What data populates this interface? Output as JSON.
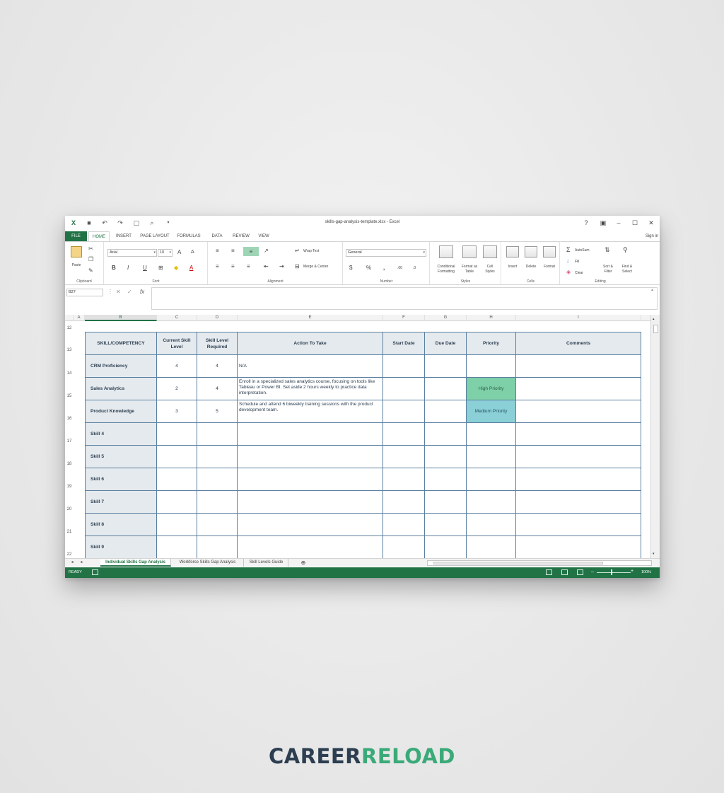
{
  "window": {
    "title": "skills-gap-analysis-template.xlsx - Excel",
    "help": "?",
    "sign_in": "Sign in"
  },
  "ribbon_tabs": [
    "FILE",
    "HOME",
    "INSERT",
    "PAGE LAYOUT",
    "FORMULAS",
    "DATA",
    "REVIEW",
    "VIEW"
  ],
  "ribbon": {
    "paste": "Paste",
    "clipboard": "Clipboard",
    "font_name": "Arial",
    "font_size": "10",
    "font": "Font",
    "bold": "B",
    "italic": "I",
    "underline": "U",
    "alignment": "Alignment",
    "wrap_text": "Wrap Text",
    "merge_center": "Merge & Center",
    "number_format": "General",
    "number": "Number",
    "currency": "$",
    "percent": "%",
    "comma": ",",
    "conditional_formatting": [
      "Conditional",
      "Formatting"
    ],
    "format_as_table": [
      "Format as",
      "Table"
    ],
    "cell_styles": [
      "Cell",
      "Styles"
    ],
    "styles": "Styles",
    "insert": "Insert",
    "delete": "Delete",
    "format": "Format",
    "cells": "Cells",
    "autosum": "AutoSum",
    "fill": "Fill",
    "clear": "Clear",
    "sort_filter": [
      "Sort &",
      "Filter"
    ],
    "find_select": [
      "Find &",
      "Select"
    ],
    "editing": "Editing"
  },
  "formula_bar": {
    "name_box": "B27",
    "fx": "fx",
    "value": ""
  },
  "columns": [
    "A",
    "B",
    "C",
    "D",
    "E",
    "F",
    "G",
    "H",
    "I"
  ],
  "rows": [
    "12",
    "13",
    "14",
    "15",
    "16",
    "17",
    "18",
    "19",
    "20",
    "21",
    "22"
  ],
  "table": {
    "headers": [
      "SKILL/COMPETENCY",
      "Current Skill Level",
      "Skill Level Required",
      "Action To Take",
      "Start Date",
      "Due Date",
      "Priority",
      "Comments"
    ],
    "rows": [
      {
        "skill": "CRM Proficiency",
        "current": "4",
        "required": "4",
        "action": "N/A",
        "start": "",
        "due": "",
        "priority": "",
        "comments": ""
      },
      {
        "skill": "Sales Analytics",
        "current": "2",
        "required": "4",
        "action": "Enroll in a specialized sales analytics course, focusing on tools like Tableau or Power BI. Set aside 2 hours weekly to practice data interpretation.",
        "start": "",
        "due": "",
        "priority": "High Priority",
        "comments": ""
      },
      {
        "skill": "Product Knowledge",
        "current": "3",
        "required": "5",
        "action": "Schedule and attend 6 biweekly training sessions with the product development team.",
        "start": "",
        "due": "",
        "priority": "Medium Priority",
        "comments": ""
      },
      {
        "skill": "Skill 4",
        "current": "",
        "required": "",
        "action": "",
        "start": "",
        "due": "",
        "priority": "",
        "comments": ""
      },
      {
        "skill": "Skill 5",
        "current": "",
        "required": "",
        "action": "",
        "start": "",
        "due": "",
        "priority": "",
        "comments": ""
      },
      {
        "skill": "Skill 6",
        "current": "",
        "required": "",
        "action": "",
        "start": "",
        "due": "",
        "priority": "",
        "comments": ""
      },
      {
        "skill": "Skill 7",
        "current": "",
        "required": "",
        "action": "",
        "start": "",
        "due": "",
        "priority": "",
        "comments": ""
      },
      {
        "skill": "Skill 8",
        "current": "",
        "required": "",
        "action": "",
        "start": "",
        "due": "",
        "priority": "",
        "comments": ""
      },
      {
        "skill": "Skill 9",
        "current": "",
        "required": "",
        "action": "",
        "start": "",
        "due": "",
        "priority": "",
        "comments": ""
      }
    ]
  },
  "sheet_tabs": [
    "Individual Skills Gap Analysis",
    "Workforce Skills Gap Analysis",
    "Skill Levels Guide"
  ],
  "status": {
    "ready": "READY",
    "zoom": "100%"
  },
  "logo": {
    "part1": "CAREER",
    "part2": "RELOAD"
  },
  "colors": {
    "excel_green": "#217346",
    "high_priority": "#7ed0a8",
    "medium_priority": "#8ad0d6",
    "header_fill": "#e5eaee",
    "logo_dark": "#2c3e50",
    "logo_green": "#3aaa78"
  }
}
